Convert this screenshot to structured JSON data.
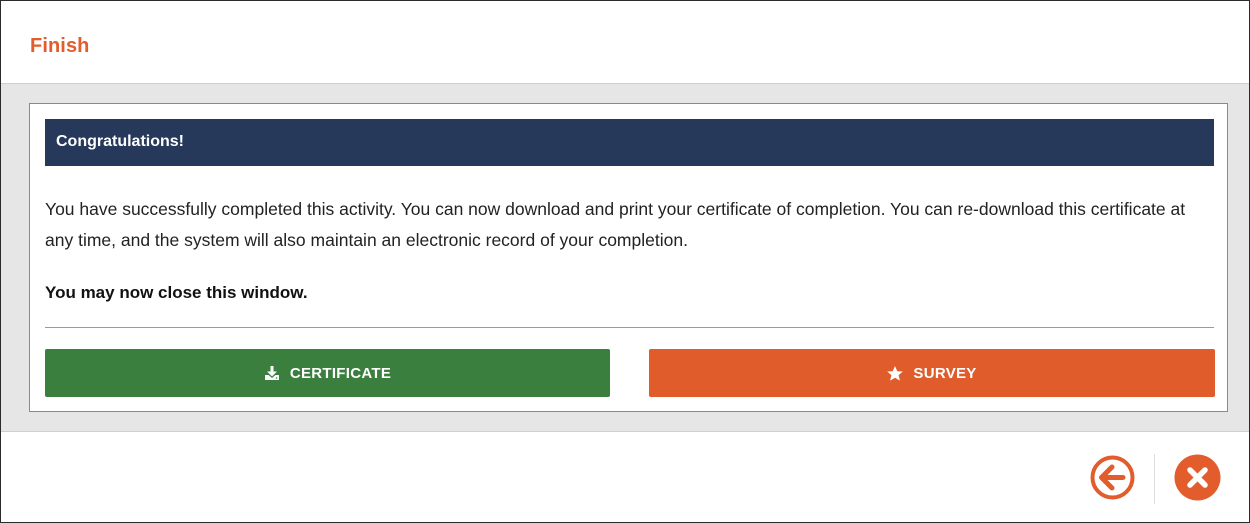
{
  "header": {
    "title": "Finish"
  },
  "banner": {
    "title": "Congratulations!"
  },
  "message": {
    "body": "You have successfully completed this activity. You can now download and print your certificate of completion. You can re-download this certificate at any time, and the system will also maintain an electronic record of your completion.",
    "close_note": "You may now close this window."
  },
  "buttons": {
    "certificate": {
      "label": "CERTIFICATE",
      "icon": "download-icon",
      "color": "#3a7f3e"
    },
    "survey": {
      "label": "SURVEY",
      "icon": "star-icon",
      "color": "#e05d2b"
    }
  },
  "footer": {
    "back": {
      "icon": "arrow-left-circle-icon",
      "color": "#e25c2c"
    },
    "close": {
      "icon": "close-circle-icon",
      "color": "#e25c2c"
    }
  },
  "colors": {
    "accent": "#e25c2c",
    "banner": "#27395a"
  }
}
